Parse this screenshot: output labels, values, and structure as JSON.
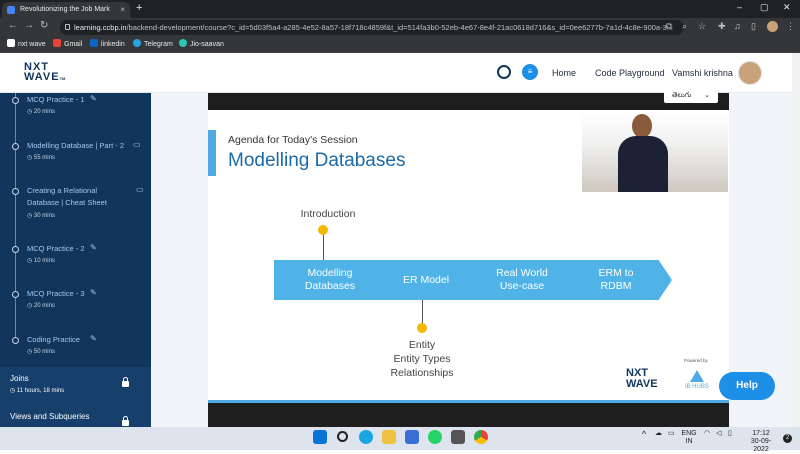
{
  "browser": {
    "tab_title": "Revolutionizing the Job Mark",
    "tab_close": "×",
    "new_tab": "+",
    "url_domain": "learning.ccbp.in",
    "url_path": "/backend-development/course?c_id=5d03f5a4-a285-4e52-8a57-18f718c4859f&t_id=514fa3b0-52eb-4e67-8e4f-21ac0618d716&s_id=0ee6277b-7a1d-4c8e-900a-3...",
    "bookmarks": [
      {
        "label": "nxt wave",
        "color": "#ffffff"
      },
      {
        "label": "Gmail",
        "color": "#ea4335"
      },
      {
        "label": "linkedin",
        "color": "#0a66c2"
      },
      {
        "label": "Telegram",
        "color": "#2aa3df"
      },
      {
        "label": "Jio-saavan",
        "color": "#2bc5b4"
      }
    ]
  },
  "header": {
    "logo_line1": "NXT",
    "logo_line2": "WAVE",
    "logo_tm": "TM",
    "nav_home": "Home",
    "nav_playground": "Code Playground",
    "user_name": "Vamshi krishna"
  },
  "sidebar": {
    "items": [
      {
        "title": "MCQ Practice - 1",
        "duration": "20 mins",
        "icon": "pencil-icon"
      },
      {
        "title": "Modelling Database | Part - 2",
        "duration": "55 mins",
        "icon": "book-icon"
      },
      {
        "title": "Creating a Relational\nDatabase | Cheat Sheet",
        "duration": "30 mins",
        "icon": "book-icon"
      },
      {
        "title": "MCQ Practice - 2",
        "duration": "10 mins",
        "icon": "pencil-icon"
      },
      {
        "title": "MCQ Practice - 3",
        "duration": "20 mins",
        "icon": "pencil-icon"
      },
      {
        "title": "Coding Practice",
        "duration": "50 mins",
        "icon": "pencil-icon"
      }
    ],
    "sections": [
      {
        "title": "Joins",
        "meta": "11 hours, 18 mins"
      },
      {
        "title": "Views and Subqueries",
        "meta": ""
      }
    ]
  },
  "video": {
    "language_select": "తెలుగు",
    "agenda": "Agenda for Today's Session",
    "title": "Modelling Databases",
    "top_milestone": "Introduction",
    "steps": [
      "Modelling\nDatabases",
      "ER Model",
      "Real World\nUse-case",
      "ERM to\nRDBM"
    ],
    "bottom_milestone": "Entity\nEntity Types\nRelationships",
    "brand_line1": "NXT",
    "brand_line2": "WAVE",
    "powered_by": "Powered by",
    "ibhubs": "iB HUBS"
  },
  "help_button": "Help",
  "taskbar": {
    "lang": "ENG",
    "region": "IN",
    "time": "17:12",
    "date": "30-09-2022",
    "notification_count": "2"
  }
}
